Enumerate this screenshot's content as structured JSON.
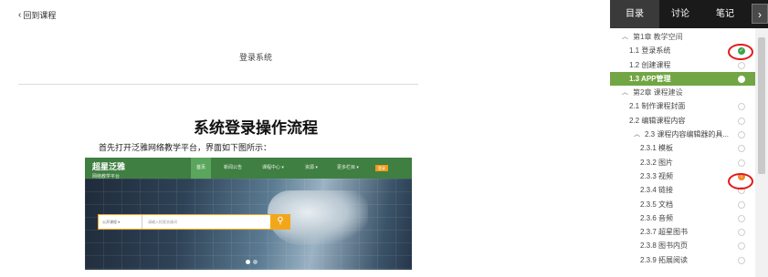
{
  "back_link": "回到课程",
  "section_title": "登录系统",
  "heading": "系统登录操作流程",
  "intro": "首先打开泛雅网络教学平台，界面如下图所示：",
  "platform": {
    "logo_line1": "超星泛雅",
    "logo_line2": "网络教学平台",
    "menu": [
      "首页",
      "新闻公告",
      "课程中心 ▾",
      "资源 ▾",
      "更多栏目 ▾"
    ],
    "register": "登录",
    "search_select": "公开课程",
    "search_placeholder": "请输入检索关键词",
    "search_icon": "search-icon"
  },
  "tabs": {
    "catalog": "目录",
    "discussion": "讨论",
    "notes": "笔记",
    "next": "›"
  },
  "toc": [
    {
      "label": "第1章 教学空间",
      "type": "chapter"
    },
    {
      "label": "1.1 登录系统",
      "type": "item",
      "status": "done"
    },
    {
      "label": "1.2 创建课程",
      "type": "item",
      "status": "none"
    },
    {
      "label": "1.3 APP管理",
      "type": "item",
      "status": "active"
    },
    {
      "label": "第2章 课程建设",
      "type": "chapter"
    },
    {
      "label": "2.1 制作课程封面",
      "type": "item",
      "status": "none"
    },
    {
      "label": "2.2 编辑课程内容",
      "type": "item",
      "status": "none"
    },
    {
      "label": "2.3 课程内容编辑器的具...",
      "type": "subchapter",
      "status": "none"
    },
    {
      "label": "2.3.1 模板",
      "type": "sub",
      "status": "none"
    },
    {
      "label": "2.3.2 图片",
      "type": "sub",
      "status": "none"
    },
    {
      "label": "2.3.3 视频",
      "type": "sub",
      "status": "warn"
    },
    {
      "label": "2.3.4 链接",
      "type": "sub",
      "status": "none"
    },
    {
      "label": "2.3.5 文档",
      "type": "sub",
      "status": "none"
    },
    {
      "label": "2.3.6 音频",
      "type": "sub",
      "status": "none"
    },
    {
      "label": "2.3.7 超星图书",
      "type": "sub",
      "status": "none"
    },
    {
      "label": "2.3.8 图书内页",
      "type": "sub",
      "status": "none"
    },
    {
      "label": "2.3.9 拓展阅读",
      "type": "sub",
      "status": "none"
    }
  ],
  "colors": {
    "accent": "#72a645",
    "done": "#3da34a",
    "warn": "#ef8a2c",
    "highlight_ring": "#e21b1b"
  }
}
